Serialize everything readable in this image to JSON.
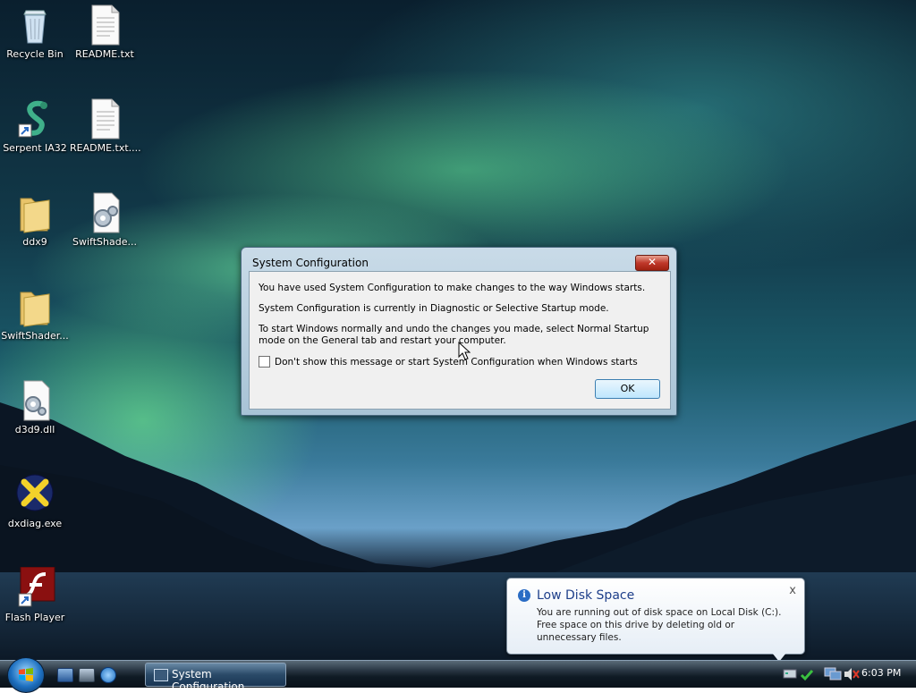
{
  "desktop": {
    "icons": [
      {
        "label": "Recycle Bin",
        "icon": "recycle-bin-icon"
      },
      {
        "label": "README.txt",
        "icon": "text-file-icon"
      },
      {
        "label": "Serpent IA32",
        "icon": "serpent-shortcut-icon"
      },
      {
        "label": "README.txt....",
        "icon": "text-file-icon"
      },
      {
        "label": "ddx9",
        "icon": "folder-icon"
      },
      {
        "label": "SwiftShade...",
        "icon": "config-file-icon"
      },
      {
        "label": "SwiftShader...",
        "icon": "folder-icon"
      },
      {
        "label": "d3d9.dll",
        "icon": "dll-file-icon"
      },
      {
        "label": "dxdiag.exe",
        "icon": "dxdiag-icon"
      },
      {
        "label": "Flash Player",
        "icon": "flash-player-shortcut-icon"
      }
    ]
  },
  "dialog": {
    "title": "System Configuration",
    "close_symbol": "✕",
    "line1": "You have used System Configuration to make changes to the way Windows starts.",
    "line2": "System Configuration is currently in Diagnostic or Selective Startup mode.",
    "line3": "To start Windows normally and undo the changes you made, select Normal Startup mode on the General tab and restart your computer.",
    "checkbox_label": "Don't show this message or start System Configuration when Windows starts",
    "checkbox_checked": false,
    "ok_label": "OK"
  },
  "balloon": {
    "title": "Low Disk Space",
    "close_symbol": "x",
    "message": "You are running out of disk space on Local Disk (C:). Free space on this drive by deleting old or unnecessary files."
  },
  "taskbar": {
    "task_label": "System Configuration",
    "clock": "6:03 PM"
  },
  "colors": {
    "accent": "#1e3f8a",
    "close_red": "#c0392b",
    "taskbar": "#0f1a24"
  }
}
